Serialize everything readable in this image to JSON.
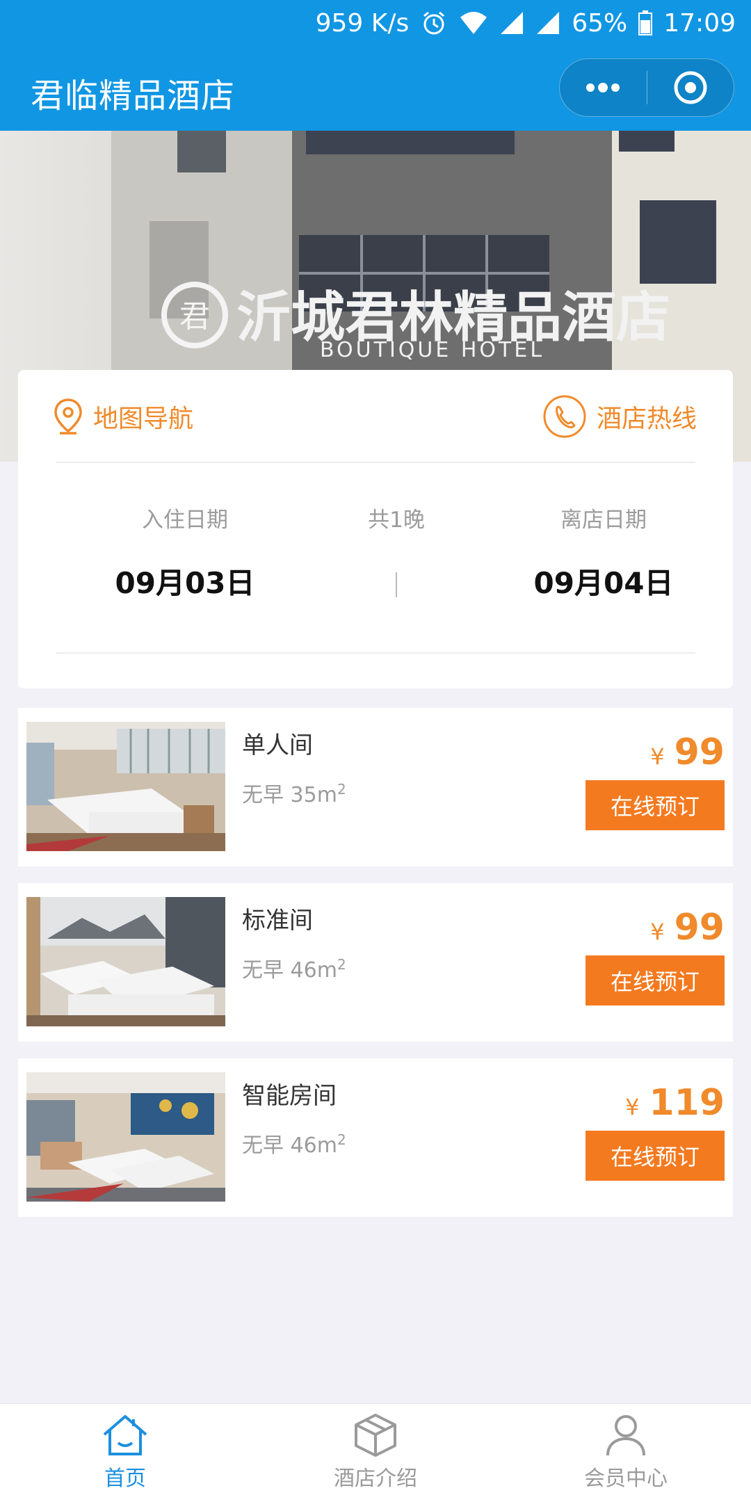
{
  "status_bar": {
    "speed": "959 K/s",
    "battery": "65%",
    "time": "17:09"
  },
  "nav": {
    "title": "君临精品酒店"
  },
  "banner": {
    "sign_text": "沂城君林精品酒店",
    "sign_subtext": "BOUTIQUE HOTEL"
  },
  "info": {
    "map_label": "地图导航",
    "hotline_label": "酒店热线",
    "checkin_label": "入住日期",
    "checkin_date": "09月03日",
    "nights_label": "共1晚",
    "checkout_label": "离店日期",
    "checkout_date": "09月04日"
  },
  "rooms": [
    {
      "name": "单人间",
      "desc": "无早 35m",
      "currency": "¥",
      "price": "99",
      "button": "在线预订"
    },
    {
      "name": "标准间",
      "desc": "无早 46m",
      "currency": "¥",
      "price": "99",
      "button": "在线预订"
    },
    {
      "name": "智能房间",
      "desc": "无早 46m",
      "currency": "¥",
      "price": "119",
      "button": "在线预订"
    }
  ],
  "area_superscript": "2",
  "tabs": [
    {
      "label": "首页",
      "icon": "home-icon",
      "active": true
    },
    {
      "label": "酒店介绍",
      "icon": "box-icon",
      "active": false
    },
    {
      "label": "会员中心",
      "icon": "user-icon",
      "active": false
    }
  ],
  "colors": {
    "header_blue": "#1196e3",
    "accent_orange": "#f08a2b",
    "button_orange": "#f47a20",
    "tab_active": "#1a8fe0"
  }
}
